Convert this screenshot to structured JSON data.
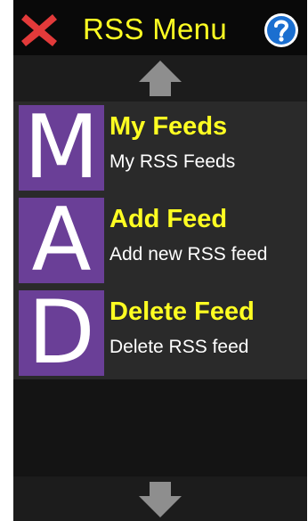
{
  "header": {
    "title": "RSS Menu",
    "close_icon": "close-x-icon",
    "help_icon": "help-question-icon",
    "close_color": "#e23a3a",
    "help_color": "#1b6fd0"
  },
  "navigation": {
    "up_icon": "arrow-up-icon",
    "down_icon": "arrow-down-icon"
  },
  "menu": {
    "items": [
      {
        "letter": "M",
        "title": "My Feeds",
        "subtitle": "My RSS Feeds"
      },
      {
        "letter": "A",
        "title": "Add Feed",
        "subtitle": "Add new RSS feed"
      },
      {
        "letter": "D",
        "title": "Delete Feed",
        "subtitle": "Delete RSS feed"
      }
    ]
  },
  "colors": {
    "title_yellow": "#ffff22",
    "tile_purple": "#6a3f97",
    "background": "#141414"
  }
}
